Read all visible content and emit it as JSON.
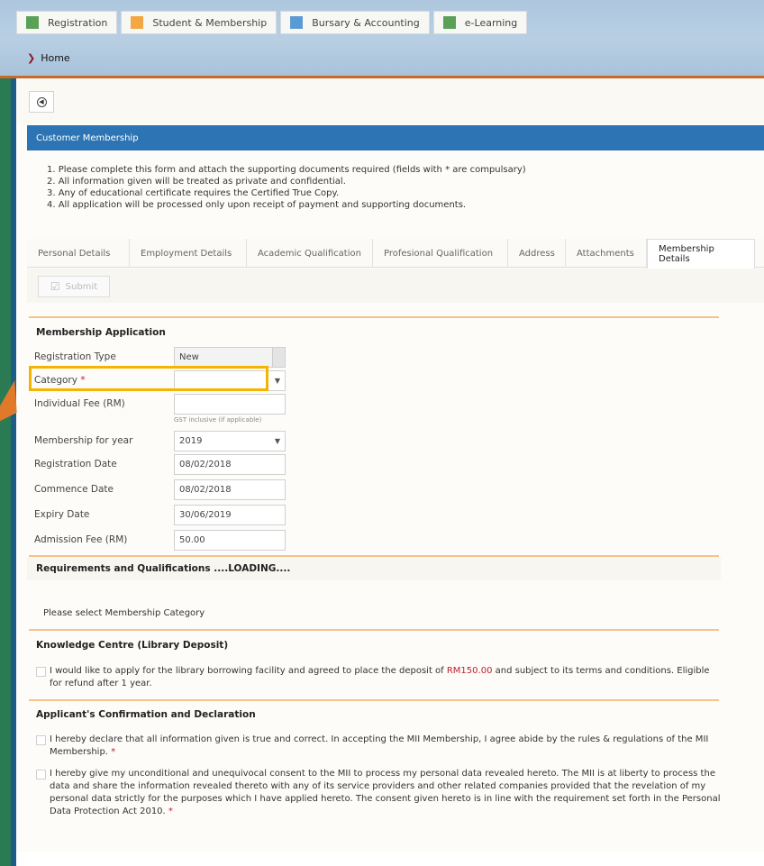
{
  "app_tabs": [
    {
      "label": "Registration",
      "color": "#5aa057"
    },
    {
      "label": "Student & Membership",
      "color": "#f2a743"
    },
    {
      "label": "Bursary & Accounting",
      "color": "#5b9bd5"
    },
    {
      "label": "e-Learning",
      "color": "#5aa057"
    }
  ],
  "breadcrumb": {
    "home": "Home"
  },
  "panel": {
    "title": "Customer Membership"
  },
  "notes": [
    "1. Please complete this form and attach the supporting documents required (fields with * are compulsary)",
    "2. All information given will be treated as private and confidential.",
    "3. Any of educational certificate requires the Certified True Copy.",
    "4. All application will be processed only upon receipt of payment and supporting documents."
  ],
  "tabs": [
    "Personal Details",
    "Employment Details",
    "Academic Qualification",
    "Profesional Qualification",
    "Address",
    "Attachments",
    "Membership Details"
  ],
  "toolbar": {
    "submit_label": "Submit"
  },
  "form": {
    "section_title": "Membership Application",
    "registration_type": {
      "label": "Registration Type",
      "value": "New"
    },
    "category": {
      "label": "Category",
      "value": ""
    },
    "individual_fee": {
      "label": "Individual Fee (RM)",
      "value": "",
      "hint": "GST inclusive (if applicable)"
    },
    "membership_year": {
      "label": "Membership for year",
      "value": "2019"
    },
    "registration_date": {
      "label": "Registration Date",
      "value": "08/02/2018"
    },
    "commence_date": {
      "label": "Commence Date",
      "value": "08/02/2018"
    },
    "expiry_date": {
      "label": "Expiry Date",
      "value": "30/06/2019"
    },
    "admission_fee": {
      "label": "Admission Fee (RM)",
      "value": "50.00"
    }
  },
  "requirements": {
    "title": "Requirements and Qualifications ....LOADING....",
    "message": "Please select Membership Category"
  },
  "knowledge_centre": {
    "title": "Knowledge Centre (Library Deposit)",
    "text_before": "I would like to apply for the library borrowing facility and agreed to place the deposit of ",
    "deposit": "RM150.00",
    "text_after": " and subject to its terms and conditions. Eligible for refund after 1 year."
  },
  "declaration": {
    "title": "Applicant's Confirmation and Declaration",
    "item1": "I hereby declare that all information given is true and correct. In accepting the MII Membership, I agree abide by the rules & regulations of the MII Membership.",
    "item2": "I hereby give my unconditional and unequivocal consent to the MII to process my personal data revealed hereto. The MII is at liberty to process the data and share the information revealed thereto with any of its service providers and other related companies provided that the revelation of my personal data strictly for the purposes which I have applied hereto. The consent given hereto is in line with the requirement set forth in the Personal Data Protection Act 2010."
  },
  "required_marker": "*"
}
